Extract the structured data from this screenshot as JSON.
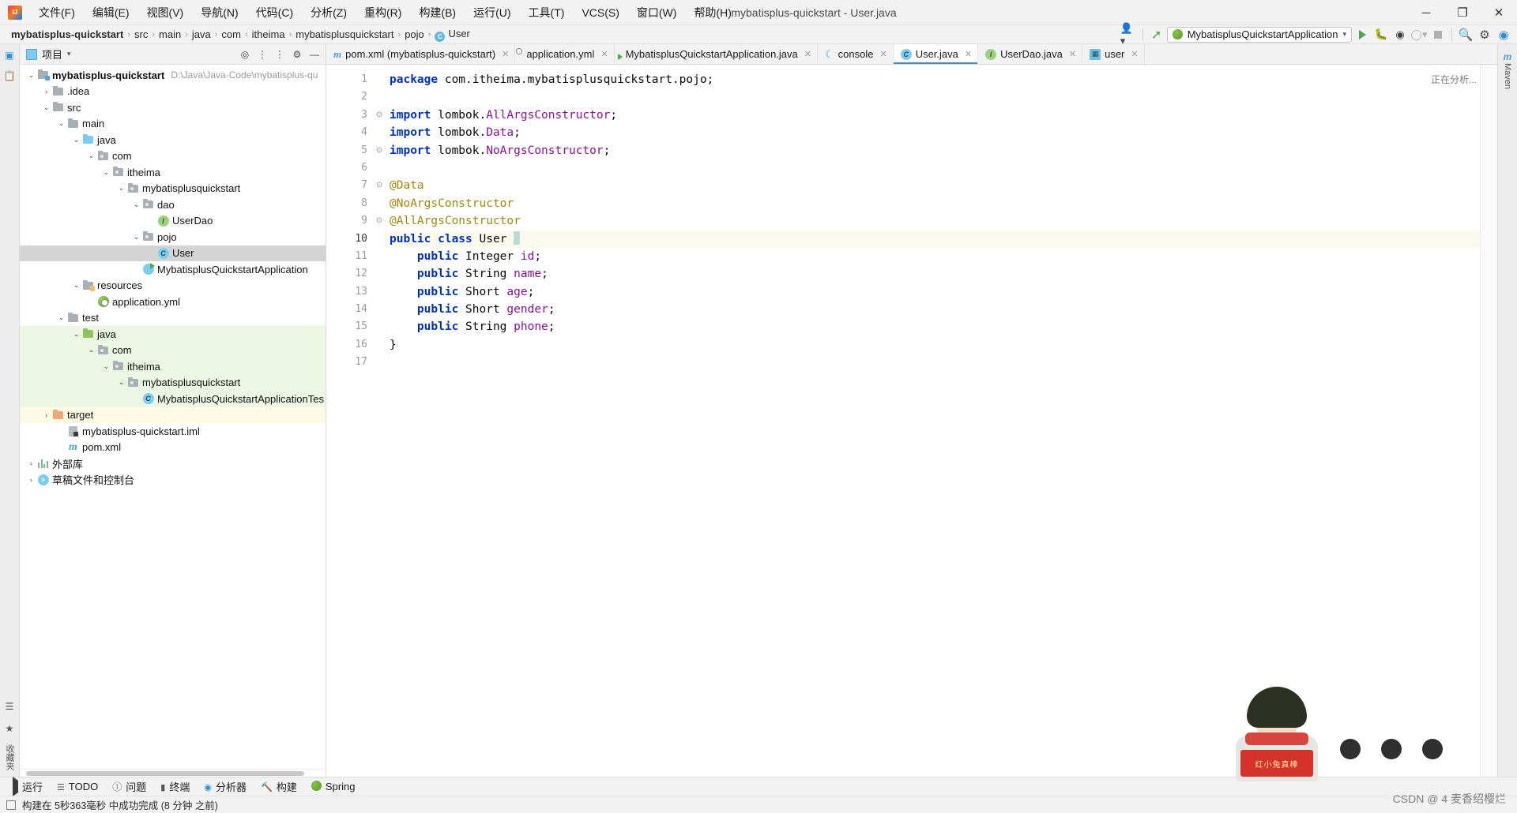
{
  "window": {
    "title": "mybatisplus-quickstart - User.java",
    "minimize": "─",
    "maximize": "❐",
    "close": "✕"
  },
  "menubar": {
    "logo": "intellij-idea-logo",
    "items": [
      "文件(F)",
      "编辑(E)",
      "视图(V)",
      "导航(N)",
      "代码(C)",
      "分析(Z)",
      "重构(R)",
      "构建(B)",
      "运行(U)",
      "工具(T)",
      "VCS(S)",
      "窗口(W)",
      "帮助(H)"
    ]
  },
  "navbar": {
    "crumbs": [
      "mybatisplus-quickstart",
      "src",
      "main",
      "java",
      "com",
      "itheima",
      "mybatisplusquickstart",
      "pojo",
      "User"
    ],
    "separator": "›",
    "user_icon": "user-avatar-icon",
    "hammer_icon": "build-hammer-icon",
    "run_config": "MybatisplusQuickstartApplication",
    "run_config_caret": "▾",
    "icons": {
      "run": "run-icon",
      "debug": "debug-icon",
      "run_coverage": "run-with-coverage-icon",
      "profiler": "profiler-icon",
      "stop": "stop-icon",
      "search": "search-everywhere-icon",
      "settings": "settings-gear-icon",
      "updates": "ide-updates-icon"
    }
  },
  "left_rail": {
    "project_label": "项目",
    "bookmarks_label": "收藏夹",
    "structure_label": "结构"
  },
  "right_rail": {
    "maven_label": "Maven"
  },
  "project_panel": {
    "title": "项目",
    "caret": "▾",
    "tools": [
      "target-icon",
      "expand-all-icon",
      "collapse-all-icon",
      "settings-icon",
      "hide-icon"
    ],
    "tree": [
      {
        "label": "mybatisplus-quickstart",
        "path": "D:\\Java\\Java-Code\\mybatisplus-qu",
        "depth": 0,
        "arrow": "⌄",
        "icon": "module-root-folder",
        "bold": true,
        "state": "normal"
      },
      {
        "label": ".idea",
        "path": "",
        "depth": 1,
        "arrow": "›",
        "icon": "folder-gray",
        "bold": false,
        "state": "normal"
      },
      {
        "label": "src",
        "path": "",
        "depth": 1,
        "arrow": "⌄",
        "icon": "folder-gray",
        "bold": false,
        "state": "normal"
      },
      {
        "label": "main",
        "path": "",
        "depth": 2,
        "arrow": "⌄",
        "icon": "folder-gray",
        "bold": false,
        "state": "normal"
      },
      {
        "label": "java",
        "path": "",
        "depth": 3,
        "arrow": "⌄",
        "icon": "folder-blue-source",
        "bold": false,
        "state": "normal"
      },
      {
        "label": "com",
        "path": "",
        "depth": 4,
        "arrow": "⌄",
        "icon": "package-folder",
        "bold": false,
        "state": "normal"
      },
      {
        "label": "itheima",
        "path": "",
        "depth": 5,
        "arrow": "⌄",
        "icon": "package-folder",
        "bold": false,
        "state": "normal"
      },
      {
        "label": "mybatisplusquickstart",
        "path": "",
        "depth": 6,
        "arrow": "⌄",
        "icon": "package-folder",
        "bold": false,
        "state": "normal"
      },
      {
        "label": "dao",
        "path": "",
        "depth": 7,
        "arrow": "⌄",
        "icon": "package-folder",
        "bold": false,
        "state": "normal"
      },
      {
        "label": "UserDao",
        "path": "",
        "depth": 8,
        "arrow": "",
        "icon": "interface-icon",
        "bold": false,
        "state": "normal"
      },
      {
        "label": "pojo",
        "path": "",
        "depth": 7,
        "arrow": "⌄",
        "icon": "package-folder",
        "bold": false,
        "state": "normal"
      },
      {
        "label": "User",
        "path": "",
        "depth": 8,
        "arrow": "",
        "icon": "class-icon",
        "bold": false,
        "state": "selected"
      },
      {
        "label": "MybatisplusQuickstartApplication",
        "path": "",
        "depth": 7,
        "arrow": "",
        "icon": "spring-run-class-icon",
        "bold": false,
        "state": "normal"
      },
      {
        "label": "resources",
        "path": "",
        "depth": 3,
        "arrow": "⌄",
        "icon": "resources-folder",
        "bold": false,
        "state": "normal"
      },
      {
        "label": "application.yml",
        "path": "",
        "depth": 4,
        "arrow": "",
        "icon": "spring-yaml-icon",
        "bold": false,
        "state": "normal"
      },
      {
        "label": "test",
        "path": "",
        "depth": 2,
        "arrow": "⌄",
        "icon": "folder-gray",
        "bold": false,
        "state": "normal"
      },
      {
        "label": "java",
        "path": "",
        "depth": 3,
        "arrow": "⌄",
        "icon": "folder-green-test",
        "bold": false,
        "state": "test"
      },
      {
        "label": "com",
        "path": "",
        "depth": 4,
        "arrow": "⌄",
        "icon": "package-folder",
        "bold": false,
        "state": "test"
      },
      {
        "label": "itheima",
        "path": "",
        "depth": 5,
        "arrow": "⌄",
        "icon": "package-folder",
        "bold": false,
        "state": "test"
      },
      {
        "label": "mybatisplusquickstart",
        "path": "",
        "depth": 6,
        "arrow": "⌄",
        "icon": "package-folder",
        "bold": false,
        "state": "test"
      },
      {
        "label": "MybatisplusQuickstartApplicationTes",
        "path": "",
        "depth": 7,
        "arrow": "",
        "icon": "class-icon",
        "bold": false,
        "state": "test"
      },
      {
        "label": "target",
        "path": "",
        "depth": 1,
        "arrow": "›",
        "icon": "folder-orange-excluded",
        "bold": false,
        "state": "target"
      },
      {
        "label": "mybatisplus-quickstart.iml",
        "path": "",
        "depth": 2,
        "arrow": "",
        "icon": "iml-file-icon",
        "bold": false,
        "state": "normal"
      },
      {
        "label": "pom.xml",
        "path": "",
        "depth": 2,
        "arrow": "",
        "icon": "maven-pom-icon",
        "bold": false,
        "state": "normal"
      },
      {
        "label": "外部库",
        "path": "",
        "depth": 0,
        "arrow": "›",
        "icon": "external-libraries-icon",
        "bold": false,
        "state": "normal"
      },
      {
        "label": "草稿文件和控制台",
        "path": "",
        "depth": 0,
        "arrow": "›",
        "icon": "scratches-consoles-icon",
        "bold": false,
        "state": "normal"
      }
    ]
  },
  "editor": {
    "tabs": [
      {
        "label": "pom.xml (mybatisplus-quickstart)",
        "icon": "maven-pom-icon",
        "active": false,
        "close": "✕"
      },
      {
        "label": "application.yml",
        "icon": "spring-yaml-icon",
        "active": false,
        "close": "✕"
      },
      {
        "label": "MybatisplusQuickstartApplication.java",
        "icon": "spring-run-class-icon",
        "active": false,
        "close": "✕"
      },
      {
        "label": "console",
        "icon": "moon-icon",
        "active": false,
        "close": "✕"
      },
      {
        "label": "User.java",
        "icon": "class-icon",
        "active": true,
        "close": "✕"
      },
      {
        "label": "UserDao.java",
        "icon": "interface-icon",
        "active": false,
        "close": "✕"
      },
      {
        "label": "user",
        "icon": "table-icon",
        "active": false,
        "close": "✕"
      }
    ],
    "analyzing_label": "正在分析...",
    "current_line": 10,
    "lines": [
      {
        "n": 1,
        "fold": "",
        "tokens": [
          {
            "t": "package ",
            "c": "kw"
          },
          {
            "t": "com.itheima.mybatisplusquickstart.pojo;",
            "c": "txt"
          }
        ]
      },
      {
        "n": 2,
        "fold": "",
        "tokens": []
      },
      {
        "n": 3,
        "fold": "⊙",
        "tokens": [
          {
            "t": "import ",
            "c": "kw"
          },
          {
            "t": "lombok.",
            "c": "txt"
          },
          {
            "t": "AllArgsConstructor",
            "c": "fld"
          },
          {
            "t": ";",
            "c": "txt"
          }
        ]
      },
      {
        "n": 4,
        "fold": "",
        "tokens": [
          {
            "t": "import ",
            "c": "kw"
          },
          {
            "t": "lombok.",
            "c": "txt"
          },
          {
            "t": "Data",
            "c": "fld"
          },
          {
            "t": ";",
            "c": "txt"
          }
        ]
      },
      {
        "n": 5,
        "fold": "⊙",
        "tokens": [
          {
            "t": "import ",
            "c": "kw"
          },
          {
            "t": "lombok.",
            "c": "txt"
          },
          {
            "t": "NoArgsConstructor",
            "c": "fld"
          },
          {
            "t": ";",
            "c": "txt"
          }
        ]
      },
      {
        "n": 6,
        "fold": "",
        "tokens": []
      },
      {
        "n": 7,
        "fold": "⊙",
        "tokens": [
          {
            "t": "@Data",
            "c": "anno"
          }
        ]
      },
      {
        "n": 8,
        "fold": "",
        "tokens": [
          {
            "t": "@NoArgsConstructor",
            "c": "anno"
          }
        ]
      },
      {
        "n": 9,
        "fold": "⊙",
        "tokens": [
          {
            "t": "@AllArgsConstructor",
            "c": "anno"
          }
        ]
      },
      {
        "n": 10,
        "fold": "",
        "tokens": [
          {
            "t": "public class ",
            "c": "kw"
          },
          {
            "t": "User ",
            "c": "txt"
          },
          {
            "t": "{",
            "c": "caret"
          }
        ]
      },
      {
        "n": 11,
        "fold": "",
        "tokens": [
          {
            "t": "    public ",
            "c": "kw"
          },
          {
            "t": "Integer ",
            "c": "txt"
          },
          {
            "t": "id",
            "c": "fld"
          },
          {
            "t": ";",
            "c": "txt"
          }
        ]
      },
      {
        "n": 12,
        "fold": "",
        "tokens": [
          {
            "t": "    public ",
            "c": "kw"
          },
          {
            "t": "String ",
            "c": "txt"
          },
          {
            "t": "name",
            "c": "fld"
          },
          {
            "t": ";",
            "c": "txt"
          }
        ]
      },
      {
        "n": 13,
        "fold": "",
        "tokens": [
          {
            "t": "    public ",
            "c": "kw"
          },
          {
            "t": "Short ",
            "c": "txt"
          },
          {
            "t": "age",
            "c": "fld"
          },
          {
            "t": ";",
            "c": "txt"
          }
        ]
      },
      {
        "n": 14,
        "fold": "",
        "tokens": [
          {
            "t": "    public ",
            "c": "kw"
          },
          {
            "t": "Short ",
            "c": "txt"
          },
          {
            "t": "gender",
            "c": "fld"
          },
          {
            "t": ";",
            "c": "txt"
          }
        ]
      },
      {
        "n": 15,
        "fold": "",
        "tokens": [
          {
            "t": "    public ",
            "c": "kw"
          },
          {
            "t": "String ",
            "c": "txt"
          },
          {
            "t": "phone",
            "c": "fld"
          },
          {
            "t": ";",
            "c": "txt"
          }
        ]
      },
      {
        "n": 16,
        "fold": "",
        "tokens": [
          {
            "t": "}",
            "c": "brace"
          }
        ]
      },
      {
        "n": 17,
        "fold": "",
        "tokens": []
      }
    ]
  },
  "bottom_bar": {
    "items": [
      {
        "label": "运行",
        "icon": "run-icon"
      },
      {
        "label": "TODO",
        "icon": "todo-icon"
      },
      {
        "label": "问题",
        "icon": "problems-icon"
      },
      {
        "label": "终端",
        "icon": "terminal-icon"
      },
      {
        "label": "分析器",
        "icon": "profiler-icon"
      },
      {
        "label": "构建",
        "icon": "build-icon"
      },
      {
        "label": "Spring",
        "icon": "spring-icon"
      }
    ]
  },
  "status_bar": {
    "message": "构建在 5秒363毫秒 中成功完成 (8 分钟 之前)",
    "icon": "build-status-icon"
  },
  "overlay": {
    "watermark": "CSDN @ 4 麦香绍樱烂",
    "badge_text": "红小兔真棒"
  },
  "colors": {
    "accent": "#4a88c7",
    "keyword": "#0033b3",
    "annotation": "#9e880d",
    "field": "#871094",
    "selection": "#d4d4d4",
    "test_bg": "#ecf6e3",
    "target_bg": "#fdfbe3"
  }
}
